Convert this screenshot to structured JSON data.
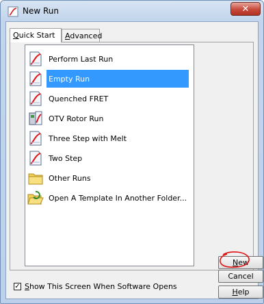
{
  "window": {
    "title": "New Run",
    "close_glyph": "✕"
  },
  "tabs": [
    {
      "label_pre": "",
      "accel": "Q",
      "label_post": "uick Start",
      "active": true
    },
    {
      "label_pre": "",
      "accel": "A",
      "label_post": "dvanced",
      "active": false
    }
  ],
  "list": {
    "items": [
      {
        "label": "Perform Last Run",
        "icon": "run-template-icon",
        "selected": false
      },
      {
        "label": "Empty Run",
        "icon": "run-template-icon",
        "selected": true
      },
      {
        "label": "Quenched FRET",
        "icon": "run-template-icon",
        "selected": false
      },
      {
        "label": "OTV Rotor Run",
        "icon": "rotor-icon",
        "selected": false
      },
      {
        "label": "Three Step with Melt",
        "icon": "run-template-icon",
        "selected": false
      },
      {
        "label": "Two Step",
        "icon": "run-template-icon",
        "selected": false
      },
      {
        "label": "Other Runs",
        "icon": "folder-icon",
        "selected": false
      },
      {
        "label": "Open A Template In Another Folder...",
        "icon": "folder-open-icon",
        "selected": false
      }
    ]
  },
  "buttons": {
    "new_accel": "N",
    "new_rest": "ew",
    "cancel": "Cancel",
    "help_accel": "H",
    "help_rest": "elp"
  },
  "footer": {
    "checkbox_checked": true,
    "check_glyph": "✓",
    "label_accel": "S",
    "label_rest": "how This Screen When Software Opens"
  },
  "colors": {
    "selection": "#3399ff",
    "annotation": "#e01010",
    "close_button": "#c7493a"
  }
}
